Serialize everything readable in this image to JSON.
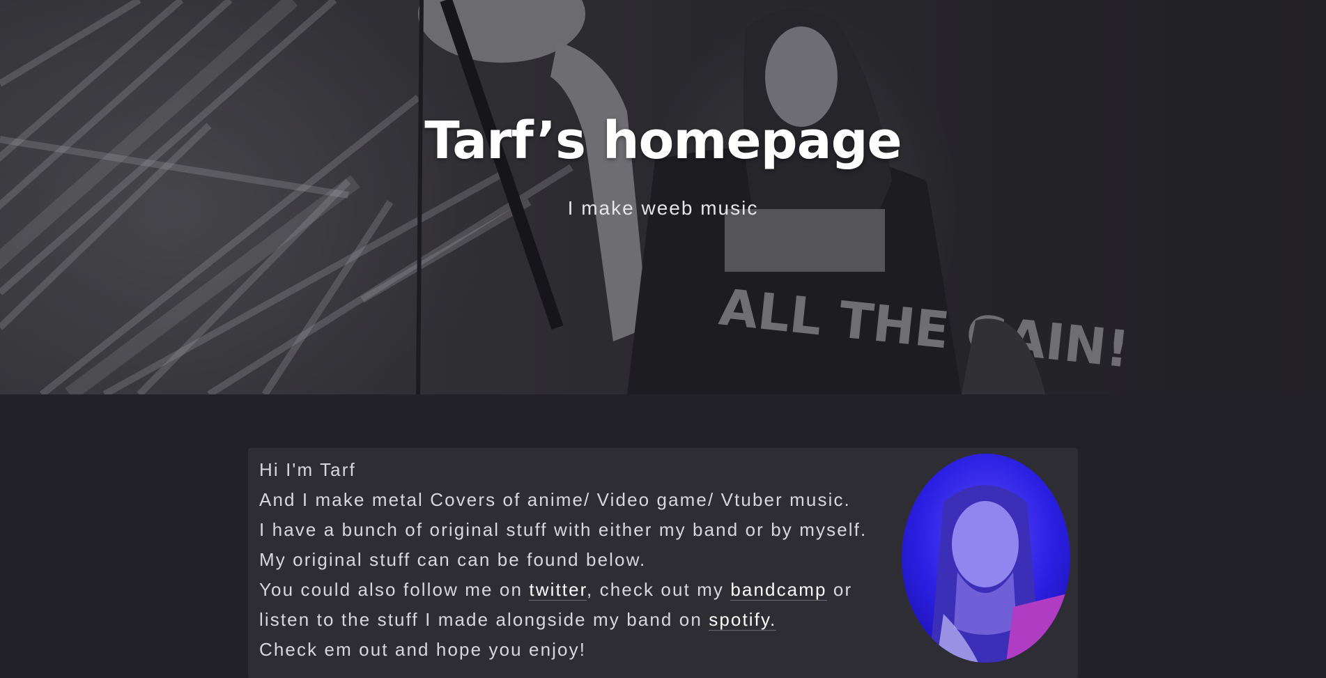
{
  "hero": {
    "title": "Tarf’s homepage",
    "subtitle": "I make weeb music",
    "shirt_text": "ALL THE GAIN!"
  },
  "intro": {
    "greeting": "Hi I'm Tarf",
    "line1": "And I make metal Covers of anime/ Video game/ Vtuber music.",
    "line2": "I have a bunch of original stuff with either my band or by myself. My original stuff can can be found below.",
    "line3_prefix": "You could also follow me on ",
    "twitter_link": "twitter",
    "line3_mid": ", check out my ",
    "bandcamp_link": "bandcamp",
    "line3_suffix": " or listen to the stuff I made alongside my band on ",
    "spotify_link": "spotify.",
    "line4": "Check em out and hope you enjoy!"
  },
  "colors": {
    "page_background": "#222127",
    "card_background": "#2e2d33",
    "text": "#d8d7dc",
    "link": "#ffffff"
  }
}
